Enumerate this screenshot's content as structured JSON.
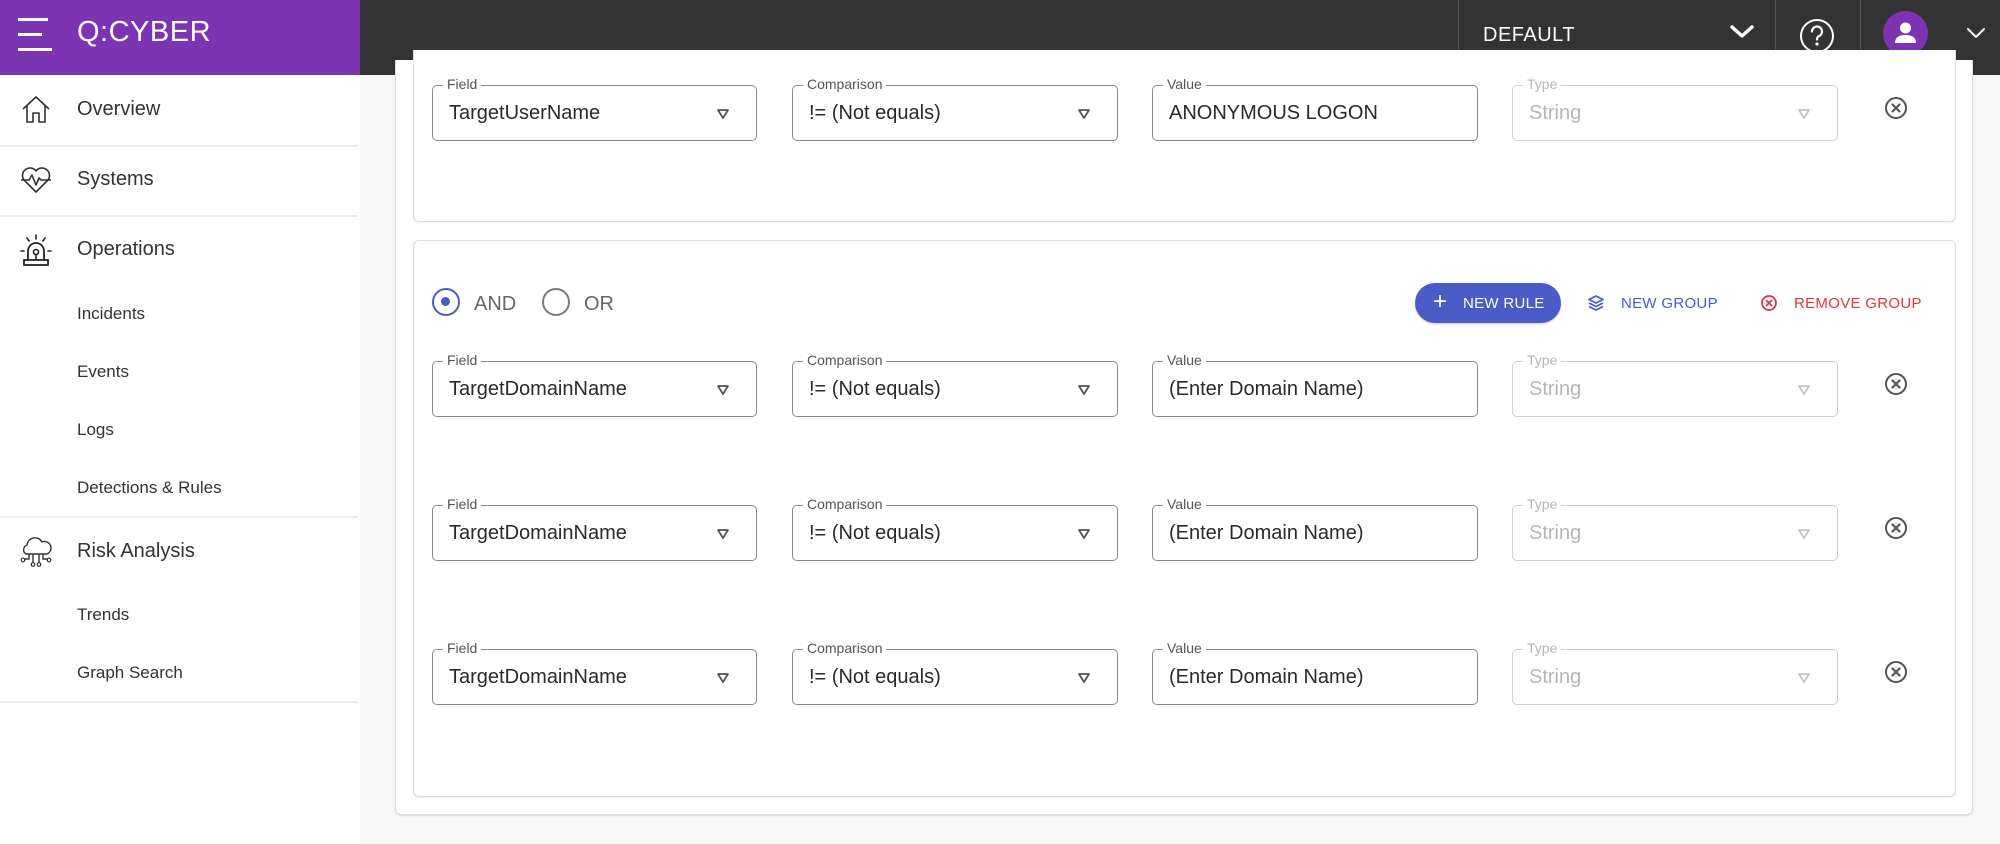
{
  "app": {
    "logo": "Q:CYBER",
    "brand_color": "#7d34b3",
    "topbar_color": "#333333",
    "accent_color": "#4a5cc7",
    "danger_color": "#e0363b"
  },
  "topbar": {
    "tenant_selector": {
      "value": "DEFAULT",
      "icon": "chevron-down-icon"
    },
    "help_icon": "help-circle-icon",
    "user_avatar_icon": "user-icon",
    "user_menu_icon": "chevron-down-icon"
  },
  "sidebar": {
    "items": [
      {
        "label": "Overview",
        "icon": "home-icon",
        "level": 1
      },
      {
        "label": "Systems",
        "icon": "heart-pulse-icon",
        "level": 1
      },
      {
        "label": "Operations",
        "icon": "alarm-siren-icon",
        "level": 1,
        "children": [
          {
            "label": "Incidents"
          },
          {
            "label": "Events"
          },
          {
            "label": "Logs"
          },
          {
            "label": "Detections & Rules"
          }
        ]
      },
      {
        "label": "Risk Analysis",
        "icon": "cloud-network-icon",
        "level": 1,
        "children": [
          {
            "label": "Trends"
          },
          {
            "label": "Graph Search"
          }
        ]
      }
    ]
  },
  "query_builder": {
    "labels": {
      "field": "Field",
      "comparison": "Comparison",
      "value": "Value",
      "type": "Type"
    },
    "groups": [
      {
        "rules": [
          {
            "field": "TargetUserName",
            "comparison": "!= (Not equals)",
            "value": "ANONYMOUS LOGON",
            "type": "String"
          }
        ]
      },
      {
        "combinator": {
          "options": [
            "AND",
            "OR"
          ],
          "selected": "AND"
        },
        "actions": {
          "new_rule": "NEW RULE",
          "new_group": "NEW GROUP",
          "remove_group": "REMOVE GROUP"
        },
        "rules": [
          {
            "field": "TargetDomainName",
            "comparison": "!= (Not equals)",
            "value": "(Enter Domain Name)",
            "type": "String"
          },
          {
            "field": "TargetDomainName",
            "comparison": "!= (Not equals)",
            "value": "(Enter Domain Name)",
            "type": "String"
          },
          {
            "field": "TargetDomainName",
            "comparison": "!= (Not equals)",
            "value": "(Enter Domain Name)",
            "type": "String"
          }
        ]
      }
    ]
  }
}
